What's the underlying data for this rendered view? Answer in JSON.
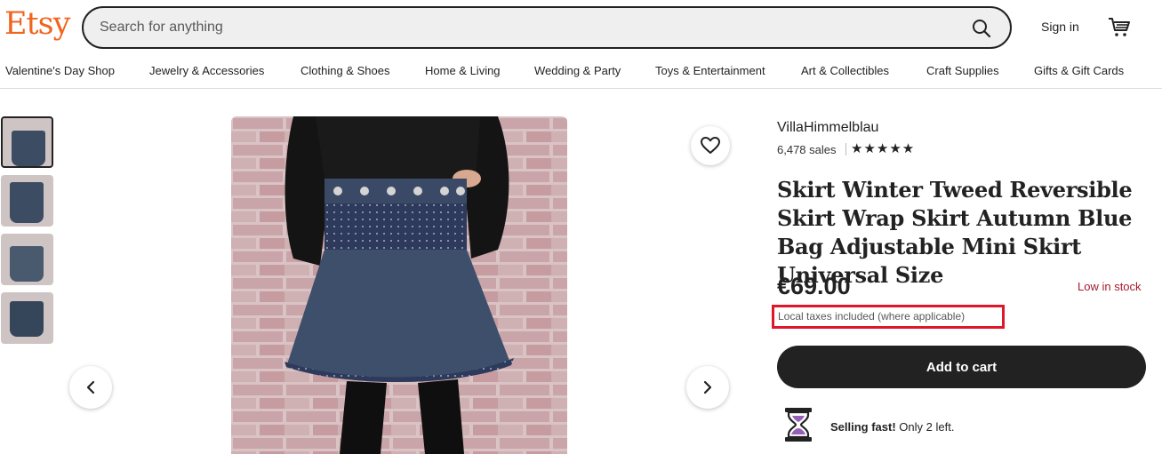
{
  "header": {
    "logo": "Etsy",
    "search_placeholder": "Search for anything",
    "signin": "Sign in",
    "brand_color": "#F1641E"
  },
  "nav": [
    "Valentine's Day Shop",
    "Jewelry & Accessories",
    "Clothing & Shoes",
    "Home & Living",
    "Wedding & Party",
    "Toys & Entertainment",
    "Art & Collectibles",
    "Craft Supplies",
    "Gifts & Gift Cards"
  ],
  "gallery": {
    "thumbnails": 4,
    "active_thumbnail": 1
  },
  "product": {
    "shop_name": "VillaHimmelblau",
    "sales": "6,478 sales",
    "rating_stars": "★★★★★",
    "title": "Skirt Winter Tweed Reversible Skirt Wrap Skirt Autumn Blue Bag Adjustable Mini Skirt Universal Size",
    "price": "€69.00",
    "stock": "Low in stock",
    "tax_note": "Local taxes included (where applicable)",
    "add_to_cart": "Add to cart",
    "selling_fast_bold": "Selling fast!",
    "selling_fast_rest": " Only 2 left."
  },
  "colors": {
    "highlight_box": "#e0162b",
    "stock_red": "#A61A2E",
    "button_dark": "#222222"
  }
}
